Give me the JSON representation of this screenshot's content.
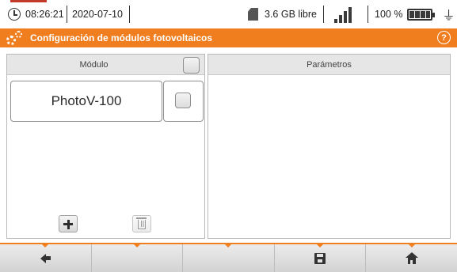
{
  "status_bar": {
    "time": "08:26:21",
    "date": "2020-07-10",
    "storage": "3.6 GB libre",
    "signal_bars": 4,
    "battery_percent": "100 %",
    "icons": [
      "clock-icon",
      "sd-card-icon",
      "signal-icon",
      "battery-icon",
      "power-plug-icon"
    ]
  },
  "title_bar": {
    "title": "Configuración de módulos fotovoltaicos",
    "icon": "gears-icon",
    "help_label": "?",
    "color": "#f07d1e"
  },
  "module_panel": {
    "header": "Módulo",
    "modules": [
      {
        "name": "PhotoV-100",
        "checked": false
      }
    ],
    "add_icon": "plus-icon",
    "delete_icon": "trash-icon"
  },
  "parameters_panel": {
    "header": "Parámetros"
  },
  "toolbar": {
    "buttons": [
      {
        "name": "back",
        "icon": "back-arrow-icon"
      },
      {
        "name": "empty-1",
        "icon": ""
      },
      {
        "name": "empty-2",
        "icon": ""
      },
      {
        "name": "save",
        "icon": "save-icon"
      },
      {
        "name": "home",
        "icon": "home-icon"
      }
    ],
    "accent": "#f07d1e"
  }
}
